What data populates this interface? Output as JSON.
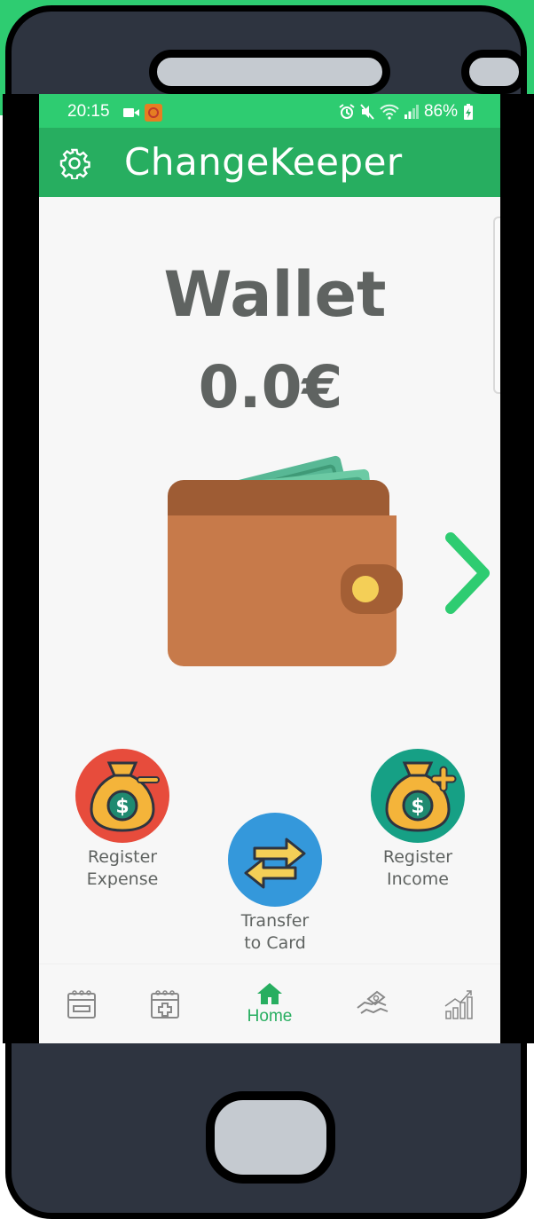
{
  "status_bar": {
    "time": "20:15",
    "battery": "86%"
  },
  "app_bar": {
    "title": "ChangeKeeper",
    "settings_icon": "gear-icon"
  },
  "wallet": {
    "title": "Wallet",
    "balance": "0.0€"
  },
  "actions": {
    "expense_line1": "Register",
    "expense_line2": "Expense",
    "transfer_line1": "Transfer",
    "transfer_line2": "to Card",
    "income_line1": "Register",
    "income_line2": "Income"
  },
  "bottom_nav": {
    "items": [
      {
        "icon": "calendar-minus-icon",
        "label": ""
      },
      {
        "icon": "calendar-plus-icon",
        "label": ""
      },
      {
        "icon": "home-icon",
        "label": "Home"
      },
      {
        "icon": "handshake-money-icon",
        "label": ""
      },
      {
        "icon": "chart-growth-icon",
        "label": ""
      }
    ]
  },
  "colors": {
    "primary": "#27ae60",
    "status_bar": "#2ecc71",
    "expense": "#e74c3c",
    "income": "#16a085",
    "transfer": "#3498db",
    "phone_body": "#2e3440",
    "text": "#5f6361"
  }
}
